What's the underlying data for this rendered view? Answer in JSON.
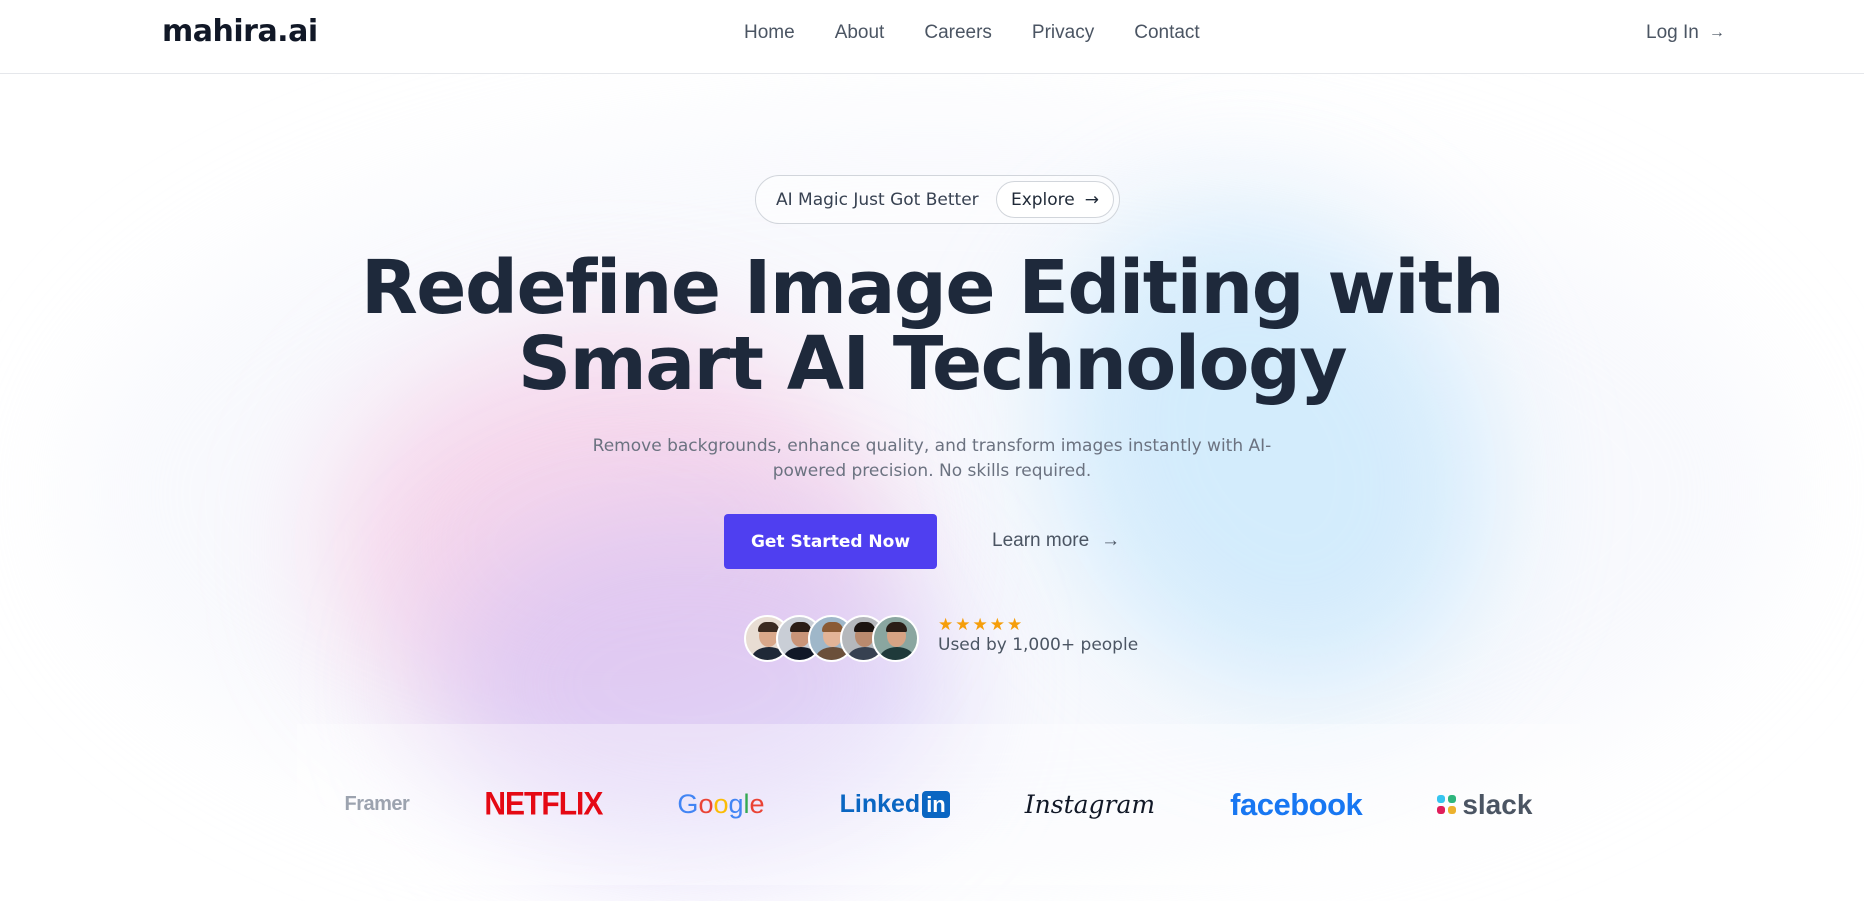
{
  "header": {
    "logo": "mahira.ai",
    "nav": [
      "Home",
      "About",
      "Careers",
      "Privacy",
      "Contact"
    ],
    "login_label": "Log In",
    "login_arrow": "→"
  },
  "hero": {
    "badge_text": "AI Magic Just Got Better",
    "badge_button": "Explore",
    "badge_arrow": "→",
    "title_line1": "Redefine Image Editing with",
    "title_line2": "Smart AI Technology",
    "subtitle": "Remove backgrounds, enhance quality, and transform images instantly with AI-powered precision. No skills required.",
    "primary_cta": "Get Started Now",
    "secondary_cta": "Learn more",
    "secondary_arrow": "→",
    "stars": "★★★★★",
    "social_proof": "Used by 1,000+ people"
  },
  "brands": {
    "framer": "Framer",
    "netflix": "NETFLIX",
    "google": [
      "G",
      "o",
      "o",
      "g",
      "l",
      "e"
    ],
    "linkedin_word": "Linked",
    "linkedin_in": "in",
    "instagram": "Instagram",
    "facebook": "facebook",
    "slack": "slack"
  },
  "colors": {
    "accent": "#4f3ff0",
    "star": "#f59e0b",
    "heading": "#1e293b"
  }
}
